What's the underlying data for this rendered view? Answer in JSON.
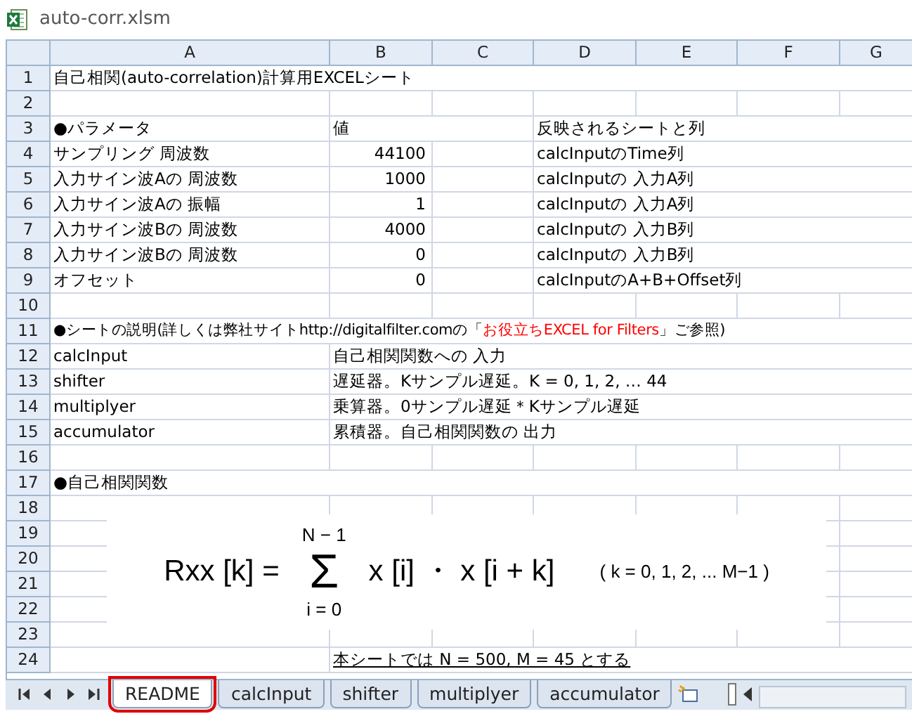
{
  "window": {
    "title": "auto-corr.xlsm"
  },
  "columns": [
    "A",
    "B",
    "C",
    "D",
    "E",
    "F",
    "G"
  ],
  "rows": [
    {
      "number": "1",
      "cells": [
        "自己相関(auto-correlation)計算用EXCELシート",
        "",
        "",
        "",
        "",
        "",
        ""
      ]
    },
    {
      "number": "2",
      "cells": [
        "",
        "",
        "",
        "",
        "",
        "",
        ""
      ]
    },
    {
      "number": "3",
      "cells": [
        "●パラメータ",
        "値",
        "",
        "反映されるシートと列",
        "",
        "",
        ""
      ]
    },
    {
      "number": "4",
      "cells": [
        "サンプリング 周波数",
        "44100",
        "",
        "calcInputのTime列",
        "",
        "",
        ""
      ]
    },
    {
      "number": "5",
      "cells": [
        "入力サイン波Aの 周波数",
        "1000",
        "",
        "calcInputの 入力A列",
        "",
        "",
        ""
      ]
    },
    {
      "number": "6",
      "cells": [
        "入力サイン波Aの 振幅",
        "1",
        "",
        "calcInputの 入力A列",
        "",
        "",
        ""
      ]
    },
    {
      "number": "7",
      "cells": [
        "入力サイン波Bの 周波数",
        "4000",
        "",
        "calcInputの 入力B列",
        "",
        "",
        ""
      ]
    },
    {
      "number": "8",
      "cells": [
        "入力サイン波Bの 周波数",
        "0",
        "",
        "calcInputの 入力B列",
        "",
        "",
        ""
      ]
    },
    {
      "number": "9",
      "cells": [
        "オフセット",
        "0",
        "",
        "calcInputのA+B+Offset列",
        "",
        "",
        ""
      ]
    },
    {
      "number": "10",
      "cells": [
        "",
        "",
        "",
        "",
        "",
        "",
        ""
      ]
    },
    {
      "number": "11",
      "cells": [
        [
          {
            "text": "●シートの説明(詳しくは弊社サイトhttp://digitalfilter.comの「",
            "highlighted": false
          },
          {
            "text": "お役立ちEXCEL for Filters",
            "highlighted": true
          },
          {
            "text": "」ご参照)",
            "highlighted": false
          }
        ],
        "",
        "",
        "",
        "",
        "",
        ""
      ]
    },
    {
      "number": "12",
      "cells": [
        "calcInput",
        "自己相関関数への 入力",
        "",
        "",
        "",
        "",
        ""
      ]
    },
    {
      "number": "13",
      "cells": [
        "shifter",
        "遅延器。Kサンプル遅延。K = 0, 1, 2, … 44",
        "",
        "",
        "",
        "",
        ""
      ]
    },
    {
      "number": "14",
      "cells": [
        "multiplyer",
        "乗算器。0サンプル遅延＊Kサンプル遅延",
        "",
        "",
        "",
        "",
        ""
      ]
    },
    {
      "number": "15",
      "cells": [
        "accumulator",
        "累積器。自己相関関数の 出力",
        "",
        "",
        "",
        "",
        ""
      ]
    },
    {
      "number": "16",
      "cells": [
        "",
        "",
        "",
        "",
        "",
        "",
        ""
      ]
    },
    {
      "number": "17",
      "cells": [
        "●自己相関関数",
        "",
        "",
        "",
        "",
        "",
        ""
      ]
    },
    {
      "number": "18",
      "cells": [
        "",
        "",
        "",
        "",
        "",
        "",
        ""
      ]
    },
    {
      "number": "19",
      "cells": [
        "",
        "",
        "",
        "",
        "",
        "",
        ""
      ]
    },
    {
      "number": "20",
      "cells": [
        "",
        "",
        "",
        "",
        "",
        "",
        ""
      ]
    },
    {
      "number": "21",
      "cells": [
        "",
        "",
        "",
        "",
        "",
        "",
        ""
      ]
    },
    {
      "number": "22",
      "cells": [
        "",
        "",
        "",
        "",
        "",
        "",
        ""
      ]
    },
    {
      "number": "23",
      "cells": [
        "",
        "",
        "",
        "",
        "",
        "",
        ""
      ]
    },
    {
      "number": "24",
      "cells": [
        "",
        "本シートでは N = 500, M = 45 とする",
        "",
        "",
        "",
        "",
        ""
      ],
      "underlined": true
    }
  ],
  "formula": {
    "lhs": "Rxx [k] =",
    "upper": "N − 1",
    "sigma": "Σ",
    "lower": "i = 0",
    "term": "x [i] ・ x [i + k]",
    "range": "( k = 0, 1, 2, ... M−1 )"
  },
  "sheet_tabs": [
    {
      "label": "README",
      "selected": true,
      "circled": true
    },
    {
      "label": "calcInput",
      "selected": false,
      "circled": false
    },
    {
      "label": "shifter",
      "selected": false,
      "circled": false
    },
    {
      "label": "multiplyer",
      "selected": false,
      "circled": false
    },
    {
      "label": "accumulator",
      "selected": false,
      "circled": false
    }
  ]
}
